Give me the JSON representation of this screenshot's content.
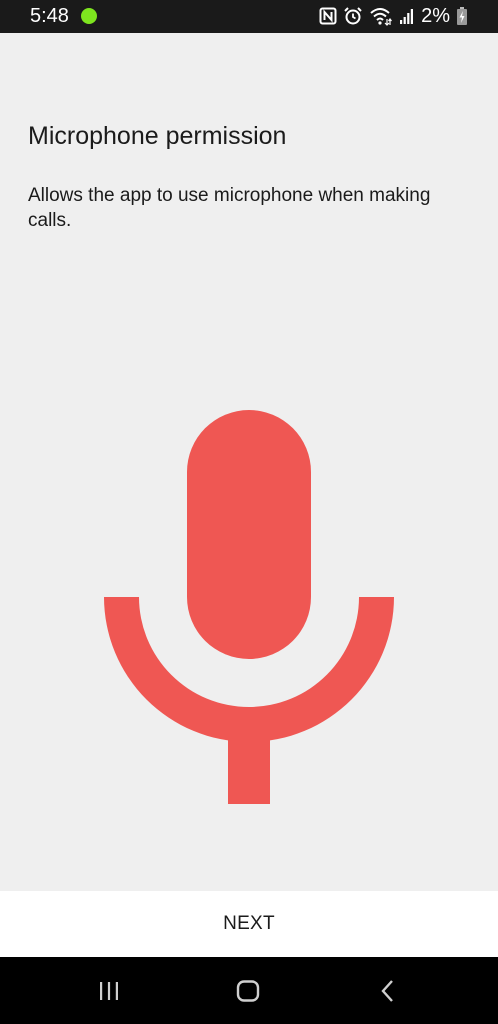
{
  "status_bar": {
    "time": "5:48",
    "battery_percent": "2%",
    "indicator_color": "#7ee51f",
    "icons": [
      "nfc-icon",
      "alarm-icon",
      "wifi-icon",
      "signal-icon",
      "battery-charging-icon"
    ]
  },
  "permission": {
    "title": "Microphone permission",
    "description": "Allows the app to use microphone when making calls.",
    "illustration_icon": "microphone-icon",
    "accent_color": "#ef5753"
  },
  "actions": {
    "next_label": "NEXT"
  },
  "nav_bar": {
    "items": [
      "recent-apps-icon",
      "home-icon",
      "back-icon"
    ]
  }
}
